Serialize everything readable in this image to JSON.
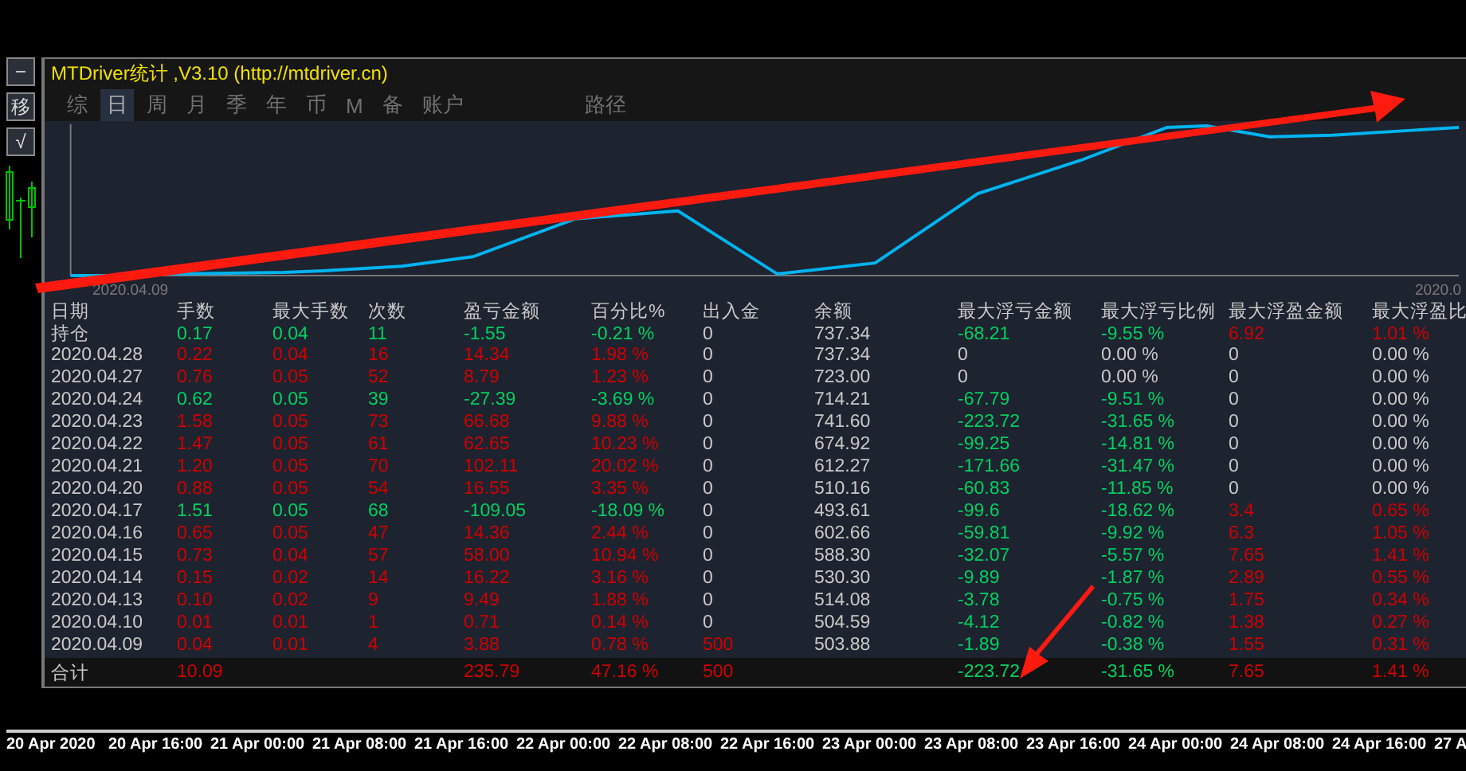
{
  "window": {
    "title": "MTDriver统计 ,V3.10 (http://mtdriver.cn)"
  },
  "side_buttons": [
    {
      "label": "−"
    },
    {
      "label": "移"
    },
    {
      "label": "√"
    }
  ],
  "tabs": [
    {
      "label": "综",
      "selected": false
    },
    {
      "label": "日",
      "selected": true
    },
    {
      "label": "周",
      "selected": false
    },
    {
      "label": "月",
      "selected": false
    },
    {
      "label": "季",
      "selected": false
    },
    {
      "label": "年",
      "selected": false
    },
    {
      "label": "币",
      "selected": false
    },
    {
      "label": "M",
      "selected": false
    },
    {
      "label": "备",
      "selected": false
    },
    {
      "label": "账户",
      "selected": false
    },
    {
      "label": "路径",
      "selected": false
    }
  ],
  "chart": {
    "start_label": "2020.04.09",
    "end_label": "2020.0"
  },
  "table": {
    "columns": [
      "日期",
      "手数",
      "最大手数",
      "次数",
      "盈亏金额",
      "百分比%",
      "出入金",
      "余额",
      "最大浮亏金额",
      "最大浮亏比例",
      "最大浮盈金额",
      "最大浮盈比"
    ],
    "rows": [
      {
        "cells": [
          {
            "text": "持仓"
          },
          {
            "text": "0.17",
            "color": "#00d060"
          },
          {
            "text": "0.04",
            "color": "#00d060"
          },
          {
            "text": "11",
            "color": "#00d060"
          },
          {
            "text": "-1.55",
            "color": "#00d060"
          },
          {
            "text": "-0.21 %",
            "color": "#00d060"
          },
          {
            "text": "0"
          },
          {
            "text": "737.34"
          },
          {
            "text": "-68.21",
            "color": "#00d060"
          },
          {
            "text": "-9.55 %",
            "color": "#00d060"
          },
          {
            "text": "6.92",
            "color": "#d00000"
          },
          {
            "text": "1.01 %",
            "color": "#d00000"
          }
        ]
      },
      {
        "cells": [
          {
            "text": "2020.04.28"
          },
          {
            "text": "0.22",
            "color": "#d00000"
          },
          {
            "text": "0.04",
            "color": "#d00000"
          },
          {
            "text": "16",
            "color": "#d00000"
          },
          {
            "text": "14.34",
            "color": "#d00000"
          },
          {
            "text": "1.98 %",
            "color": "#d00000"
          },
          {
            "text": "0"
          },
          {
            "text": "737.34"
          },
          {
            "text": "0"
          },
          {
            "text": "0.00 %"
          },
          {
            "text": "0"
          },
          {
            "text": "0.00 %"
          }
        ]
      },
      {
        "cells": [
          {
            "text": "2020.04.27"
          },
          {
            "text": "0.76",
            "color": "#d00000"
          },
          {
            "text": "0.05",
            "color": "#d00000"
          },
          {
            "text": "52",
            "color": "#d00000"
          },
          {
            "text": "8.79",
            "color": "#d00000"
          },
          {
            "text": "1.23 %",
            "color": "#d00000"
          },
          {
            "text": "0"
          },
          {
            "text": "723.00"
          },
          {
            "text": "0"
          },
          {
            "text": "0.00 %"
          },
          {
            "text": "0"
          },
          {
            "text": "0.00 %"
          }
        ]
      },
      {
        "cells": [
          {
            "text": "2020.04.24"
          },
          {
            "text": "0.62",
            "color": "#00d060"
          },
          {
            "text": "0.05",
            "color": "#00d060"
          },
          {
            "text": "39",
            "color": "#00d060"
          },
          {
            "text": "-27.39",
            "color": "#00d060"
          },
          {
            "text": "-3.69 %",
            "color": "#00d060"
          },
          {
            "text": "0"
          },
          {
            "text": "714.21"
          },
          {
            "text": "-67.79",
            "color": "#00d060"
          },
          {
            "text": "-9.51 %",
            "color": "#00d060"
          },
          {
            "text": "0"
          },
          {
            "text": "0.00 %"
          }
        ]
      },
      {
        "cells": [
          {
            "text": "2020.04.23"
          },
          {
            "text": "1.58",
            "color": "#d00000"
          },
          {
            "text": "0.05",
            "color": "#d00000"
          },
          {
            "text": "73",
            "color": "#d00000"
          },
          {
            "text": "66.68",
            "color": "#d00000"
          },
          {
            "text": "9.88 %",
            "color": "#d00000"
          },
          {
            "text": "0"
          },
          {
            "text": "741.60"
          },
          {
            "text": "-223.72",
            "color": "#00d060"
          },
          {
            "text": "-31.65 %",
            "color": "#00d060"
          },
          {
            "text": "0"
          },
          {
            "text": "0.00 %"
          }
        ]
      },
      {
        "cells": [
          {
            "text": "2020.04.22"
          },
          {
            "text": "1.47",
            "color": "#d00000"
          },
          {
            "text": "0.05",
            "color": "#d00000"
          },
          {
            "text": "61",
            "color": "#d00000"
          },
          {
            "text": "62.65",
            "color": "#d00000"
          },
          {
            "text": "10.23 %",
            "color": "#d00000"
          },
          {
            "text": "0"
          },
          {
            "text": "674.92"
          },
          {
            "text": "-99.25",
            "color": "#00d060"
          },
          {
            "text": "-14.81 %",
            "color": "#00d060"
          },
          {
            "text": "0"
          },
          {
            "text": "0.00 %"
          }
        ]
      },
      {
        "cells": [
          {
            "text": "2020.04.21"
          },
          {
            "text": "1.20",
            "color": "#d00000"
          },
          {
            "text": "0.05",
            "color": "#d00000"
          },
          {
            "text": "70",
            "color": "#d00000"
          },
          {
            "text": "102.11",
            "color": "#d00000"
          },
          {
            "text": "20.02 %",
            "color": "#d00000"
          },
          {
            "text": "0"
          },
          {
            "text": "612.27"
          },
          {
            "text": "-171.66",
            "color": "#00d060"
          },
          {
            "text": "-31.47 %",
            "color": "#00d060"
          },
          {
            "text": "0"
          },
          {
            "text": "0.00 %"
          }
        ]
      },
      {
        "cells": [
          {
            "text": "2020.04.20"
          },
          {
            "text": "0.88",
            "color": "#d00000"
          },
          {
            "text": "0.05",
            "color": "#d00000"
          },
          {
            "text": "54",
            "color": "#d00000"
          },
          {
            "text": "16.55",
            "color": "#d00000"
          },
          {
            "text": "3.35 %",
            "color": "#d00000"
          },
          {
            "text": "0"
          },
          {
            "text": "510.16"
          },
          {
            "text": "-60.83",
            "color": "#00d060"
          },
          {
            "text": "-11.85 %",
            "color": "#00d060"
          },
          {
            "text": "0"
          },
          {
            "text": "0.00 %"
          }
        ]
      },
      {
        "cells": [
          {
            "text": "2020.04.17"
          },
          {
            "text": "1.51",
            "color": "#00d060"
          },
          {
            "text": "0.05",
            "color": "#00d060"
          },
          {
            "text": "68",
            "color": "#00d060"
          },
          {
            "text": "-109.05",
            "color": "#00d060"
          },
          {
            "text": "-18.09 %",
            "color": "#00d060"
          },
          {
            "text": "0"
          },
          {
            "text": "493.61"
          },
          {
            "text": "-99.6",
            "color": "#00d060"
          },
          {
            "text": "-18.62 %",
            "color": "#00d060"
          },
          {
            "text": "3.4",
            "color": "#d00000"
          },
          {
            "text": "0.65 %",
            "color": "#d00000"
          }
        ]
      },
      {
        "cells": [
          {
            "text": "2020.04.16"
          },
          {
            "text": "0.65",
            "color": "#d00000"
          },
          {
            "text": "0.05",
            "color": "#d00000"
          },
          {
            "text": "47",
            "color": "#d00000"
          },
          {
            "text": "14.36",
            "color": "#d00000"
          },
          {
            "text": "2.44 %",
            "color": "#d00000"
          },
          {
            "text": "0"
          },
          {
            "text": "602.66"
          },
          {
            "text": "-59.81",
            "color": "#00d060"
          },
          {
            "text": "-9.92 %",
            "color": "#00d060"
          },
          {
            "text": "6.3",
            "color": "#d00000"
          },
          {
            "text": "1.05 %",
            "color": "#d00000"
          }
        ]
      },
      {
        "cells": [
          {
            "text": "2020.04.15"
          },
          {
            "text": "0.73",
            "color": "#d00000"
          },
          {
            "text": "0.04",
            "color": "#d00000"
          },
          {
            "text": "57",
            "color": "#d00000"
          },
          {
            "text": "58.00",
            "color": "#d00000"
          },
          {
            "text": "10.94 %",
            "color": "#d00000"
          },
          {
            "text": "0"
          },
          {
            "text": "588.30"
          },
          {
            "text": "-32.07",
            "color": "#00d060"
          },
          {
            "text": "-5.57 %",
            "color": "#00d060"
          },
          {
            "text": "7.65",
            "color": "#d00000"
          },
          {
            "text": "1.41 %",
            "color": "#d00000"
          }
        ]
      },
      {
        "cells": [
          {
            "text": "2020.04.14"
          },
          {
            "text": "0.15",
            "color": "#d00000"
          },
          {
            "text": "0.02",
            "color": "#d00000"
          },
          {
            "text": "14",
            "color": "#d00000"
          },
          {
            "text": "16.22",
            "color": "#d00000"
          },
          {
            "text": "3.16 %",
            "color": "#d00000"
          },
          {
            "text": "0"
          },
          {
            "text": "530.30"
          },
          {
            "text": "-9.89",
            "color": "#00d060"
          },
          {
            "text": "-1.87 %",
            "color": "#00d060"
          },
          {
            "text": "2.89",
            "color": "#d00000"
          },
          {
            "text": "0.55 %",
            "color": "#d00000"
          }
        ]
      },
      {
        "cells": [
          {
            "text": "2020.04.13"
          },
          {
            "text": "0.10",
            "color": "#d00000"
          },
          {
            "text": "0.02",
            "color": "#d00000"
          },
          {
            "text": "9",
            "color": "#d00000"
          },
          {
            "text": "9.49",
            "color": "#d00000"
          },
          {
            "text": "1.88 %",
            "color": "#d00000"
          },
          {
            "text": "0"
          },
          {
            "text": "514.08"
          },
          {
            "text": "-3.78",
            "color": "#00d060"
          },
          {
            "text": "-0.75 %",
            "color": "#00d060"
          },
          {
            "text": "1.75",
            "color": "#d00000"
          },
          {
            "text": "0.34 %",
            "color": "#d00000"
          }
        ]
      },
      {
        "cells": [
          {
            "text": "2020.04.10"
          },
          {
            "text": "0.01",
            "color": "#d00000"
          },
          {
            "text": "0.01",
            "color": "#d00000"
          },
          {
            "text": "1",
            "color": "#d00000"
          },
          {
            "text": "0.71",
            "color": "#d00000"
          },
          {
            "text": "0.14 %",
            "color": "#d00000"
          },
          {
            "text": "0"
          },
          {
            "text": "504.59"
          },
          {
            "text": "-4.12",
            "color": "#00d060"
          },
          {
            "text": "-0.82 %",
            "color": "#00d060"
          },
          {
            "text": "1.38",
            "color": "#d00000"
          },
          {
            "text": "0.27 %",
            "color": "#d00000"
          }
        ]
      },
      {
        "cells": [
          {
            "text": "2020.04.09"
          },
          {
            "text": "0.04",
            "color": "#d00000"
          },
          {
            "text": "0.01",
            "color": "#d00000"
          },
          {
            "text": "4",
            "color": "#d00000"
          },
          {
            "text": "3.88",
            "color": "#d00000"
          },
          {
            "text": "0.78 %",
            "color": "#d00000"
          },
          {
            "text": "500",
            "color": "#d00000"
          },
          {
            "text": "503.88"
          },
          {
            "text": "-1.89",
            "color": "#00d060"
          },
          {
            "text": "-0.38 %",
            "color": "#00d060"
          },
          {
            "text": "1.55",
            "color": "#d00000"
          },
          {
            "text": "0.31 %",
            "color": "#d00000"
          }
        ]
      }
    ],
    "total": {
      "label": {
        "text": "合计"
      },
      "lots": {
        "text": "10.09",
        "color": "#d00000"
      },
      "profit": {
        "text": "235.79",
        "color": "#d00000"
      },
      "percent": {
        "text": "47.16 %",
        "color": "#d00000"
      },
      "deposit": {
        "text": "500",
        "color": "#d00000"
      },
      "max_loss": {
        "text": "-223.72",
        "color": "#00d060"
      },
      "max_loss_ratio": {
        "text": "-31.65 %",
        "color": "#00d060"
      },
      "max_gain": {
        "text": "7.65",
        "color": "#d00000"
      },
      "max_gain_ratio": {
        "text": "1.41 %",
        "color": "#d00000"
      }
    }
  },
  "time_axis": [
    "20 Apr 2020",
    "20 Apr 16:00",
    "21 Apr 00:00",
    "21 Apr 08:00",
    "21 Apr 16:00",
    "22 Apr 00:00",
    "22 Apr 08:00",
    "22 Apr 16:00",
    "23 Apr 00:00",
    "23 Apr 08:00",
    "23 Apr 16:00",
    "24 Apr 00:00",
    "24 Apr 08:00",
    "24 Apr 16:00",
    "27 A"
  ]
}
